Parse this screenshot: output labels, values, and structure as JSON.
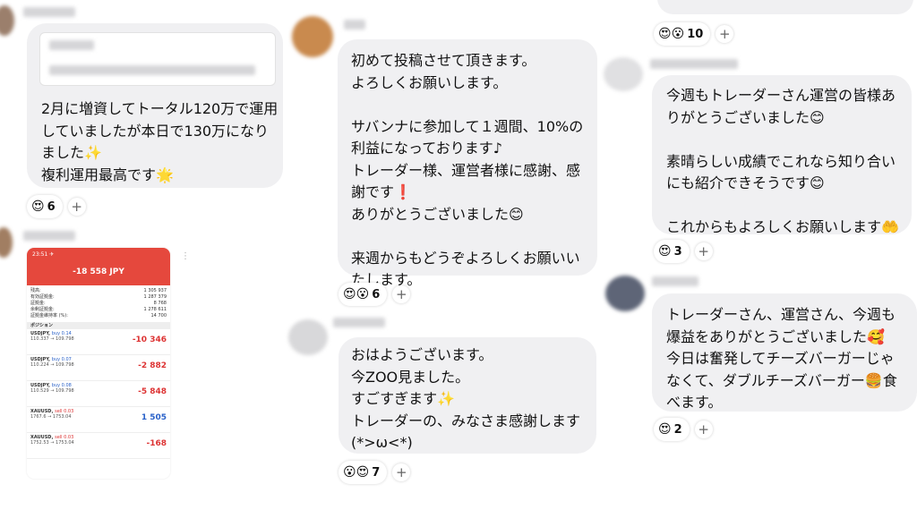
{
  "col1": {
    "post1": {
      "message": "2月に増資してトータル120万で運用\nしていましたが本日で130万になり\nました✨\n複利運用最高です🌟",
      "reaction_emoji": "😍",
      "reaction_count": "6"
    },
    "post2": {
      "app": {
        "time": "23:51 ✈",
        "total": "-18 558 JPY",
        "summary": [
          {
            "label": "残高:",
            "value": "1 305 937"
          },
          {
            "label": "有効証拠金:",
            "value": "1 287 379"
          },
          {
            "label": "証拠金:",
            "value": "8 768"
          },
          {
            "label": "余剰証拠金:",
            "value": "1 278 611"
          },
          {
            "label": "証拠金維持率 (%):",
            "value": "14 700"
          }
        ],
        "positions_label": "ポジション",
        "positions": [
          {
            "symbol": "USDJPY,",
            "side": "buy 0.14",
            "side_type": "buy",
            "price": "110.337 → 109.798",
            "pl": "-10 346",
            "sign": "neg"
          },
          {
            "symbol": "USDJPY,",
            "side": "buy 0.07",
            "side_type": "buy",
            "price": "110.224 → 109.798",
            "pl": "-2 882",
            "sign": "neg"
          },
          {
            "symbol": "USDJPY,",
            "side": "buy 0.08",
            "side_type": "buy",
            "price": "110.529 → 109.798",
            "pl": "-5 848",
            "sign": "neg"
          },
          {
            "symbol": "XAUUSD,",
            "side": "sell 0.03",
            "side_type": "sell",
            "price": "1767.6 → 1753.04",
            "pl": "1 505",
            "sign": "pos"
          },
          {
            "symbol": "XAUUSD,",
            "side": "sell 0.03",
            "side_type": "sell",
            "price": "1752.53 → 1753.04",
            "pl": "-168",
            "sign": "neg"
          }
        ]
      }
    }
  },
  "col2": {
    "post1": {
      "message": "初めて投稿させて頂きます。\nよろしくお願いします。\n\nサバンナに参加して１週間、10%の\n利益になっております♪\nトレーダー様、運営者様に感謝、感\n謝です❗\nありがとうございました😊\n\n来週からもどうぞよろしくお願いい\nたします。",
      "reaction_emoji": "😍😮",
      "reaction_count": "6"
    },
    "post2": {
      "message": "おはようございます。\n今ZOO見ました。\nすごすぎます✨\nトレーダーの、みなさま感謝します\n(*>ω<*)",
      "reaction_emoji": "😮😍",
      "reaction_count": "7"
    }
  },
  "col3": {
    "post0": {
      "reaction_emoji": "😍😮",
      "reaction_count": "10"
    },
    "post1": {
      "message": "今週もトレーダーさん運営の皆様あ\nりがとうございました😊\n\n素晴らしい成績でこれなら知り合い\nにも紹介できそうです😊\n\nこれからもよろしくお願いします🤲",
      "reaction_emoji": "😍",
      "reaction_count": "3"
    },
    "post2": {
      "message": "トレーダーさん、運営さん、今週も\n爆益をありがとうございました🥰\n今日は奮発してチーズバーガーじゃ\nなくて、ダブルチーズバーガー🍔食\nべます。",
      "reaction_emoji": "😍",
      "reaction_count": "2"
    }
  },
  "plus_symbol": "+"
}
